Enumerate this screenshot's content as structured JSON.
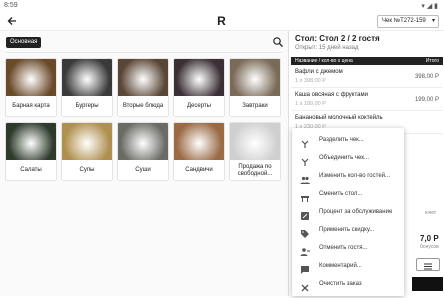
{
  "status_bar": {
    "time": "8:59",
    "indicators": "▾ ◢ ▮"
  },
  "app_bar": {
    "logo": "R",
    "receipt": "Чек №T272-159"
  },
  "category_chip": "Основная",
  "tiles": [
    {
      "label": "Барная карта",
      "color": "#6b4a2a"
    },
    {
      "label": "Бургеры",
      "color": "#3a3a3a"
    },
    {
      "label": "Вторые блюда",
      "color": "#5a4636"
    },
    {
      "label": "Десерты",
      "color": "#3b3035"
    },
    {
      "label": "Завтраки",
      "color": "#7a6a58"
    },
    {
      "label": "Салаты",
      "color": "#2e3a2c"
    },
    {
      "label": "Супы",
      "color": "#b09050"
    },
    {
      "label": "Суши",
      "color": "#6b6b66"
    },
    {
      "label": "Сандвичи",
      "color": "#9a6a44"
    },
    {
      "label": "Продажа по свободной...",
      "color": "#cfcfcf"
    }
  ],
  "order": {
    "title": "Стол: Стол 2 / 2 гостя",
    "opened": "Открыт: 15 дней назад",
    "header_name": "Название / кол-во х цена",
    "header_total": "Итого",
    "items": [
      {
        "name": "Вафли с джемом",
        "qty": "1 х 398,00 Р",
        "price": "398,00 Р"
      },
      {
        "name": "Каша овсяная с фруктами",
        "qty": "1 х 199,00 Р",
        "price": "199,00 Р"
      },
      {
        "name": "Банановый молочный коктейль",
        "qty": "1 х 230,00 Р",
        "price": ""
      }
    ],
    "service_note": "ючет",
    "total": "7,0 Р",
    "bonus": "бонусов"
  },
  "menu": [
    {
      "icon": "split-icon",
      "label": "Разделить чек..."
    },
    {
      "icon": "merge-icon",
      "label": "Объединить чек..."
    },
    {
      "icon": "guests-icon",
      "label": "Изменить кол-во гостей..."
    },
    {
      "icon": "table-icon",
      "label": "Сменить стол..."
    },
    {
      "icon": "percent-icon",
      "label": "Процент за обслуживание"
    },
    {
      "icon": "discount-tag-icon",
      "label": "Применить скидку..."
    },
    {
      "icon": "remove-guest-icon",
      "label": "Отменить гостя..."
    },
    {
      "icon": "comment-icon",
      "label": "Комментарий..."
    },
    {
      "icon": "close-icon",
      "label": "Очистить заказ"
    }
  ]
}
